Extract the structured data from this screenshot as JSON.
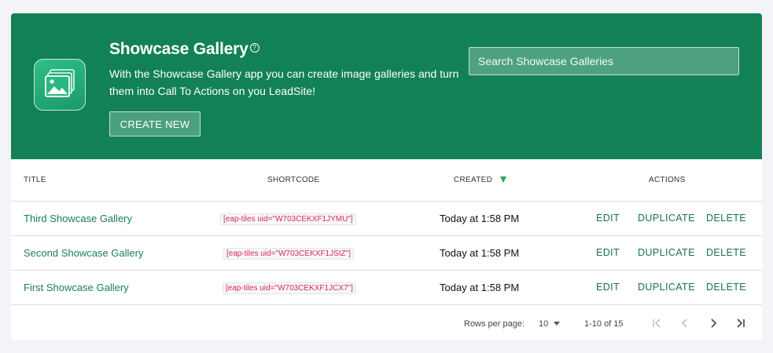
{
  "hero": {
    "title": "Showcase Gallery",
    "help_glyph": "?",
    "description": "With the Showcase Gallery app you can create image galleries and turn them into Call To Actions on you LeadSite!",
    "create_label": "CREATE NEW",
    "search_placeholder": "Search Showcase Galleries",
    "icon": "gallery-icon"
  },
  "table": {
    "headers": {
      "title": "TITLE",
      "shortcode": "SHORTCODE",
      "created": "CREATED",
      "actions": "ACTIONS"
    },
    "sort": {
      "column": "created",
      "direction": "descending"
    },
    "rows": [
      {
        "title": "Third Showcase Gallery",
        "shortcode": "[eap-tiles uid=\"W703CEKXF1JYMU\"]",
        "created": "Today at 1:58 PM"
      },
      {
        "title": "Second Showcase Gallery",
        "shortcode": "[eap-tiles uid=\"W703CEKXF1JSIZ\"]",
        "created": "Today at 1:58 PM"
      },
      {
        "title": "First Showcase Gallery",
        "shortcode": "[eap-tiles uid=\"W703CEKXF1JCX7\"]",
        "created": "Today at 1:58 PM"
      }
    ],
    "actions": {
      "edit": "EDIT",
      "duplicate": "DUPLICATE",
      "delete": "DELETE"
    }
  },
  "pagination": {
    "rows_per_page_label": "Rows per page:",
    "rows_per_page": "10",
    "range": "1-10 of 15"
  },
  "colors": {
    "brand_green": "#128156",
    "link_green": "#1a7f55",
    "shortcode_red": "#d7285f",
    "sort_green": "#22a55a"
  }
}
